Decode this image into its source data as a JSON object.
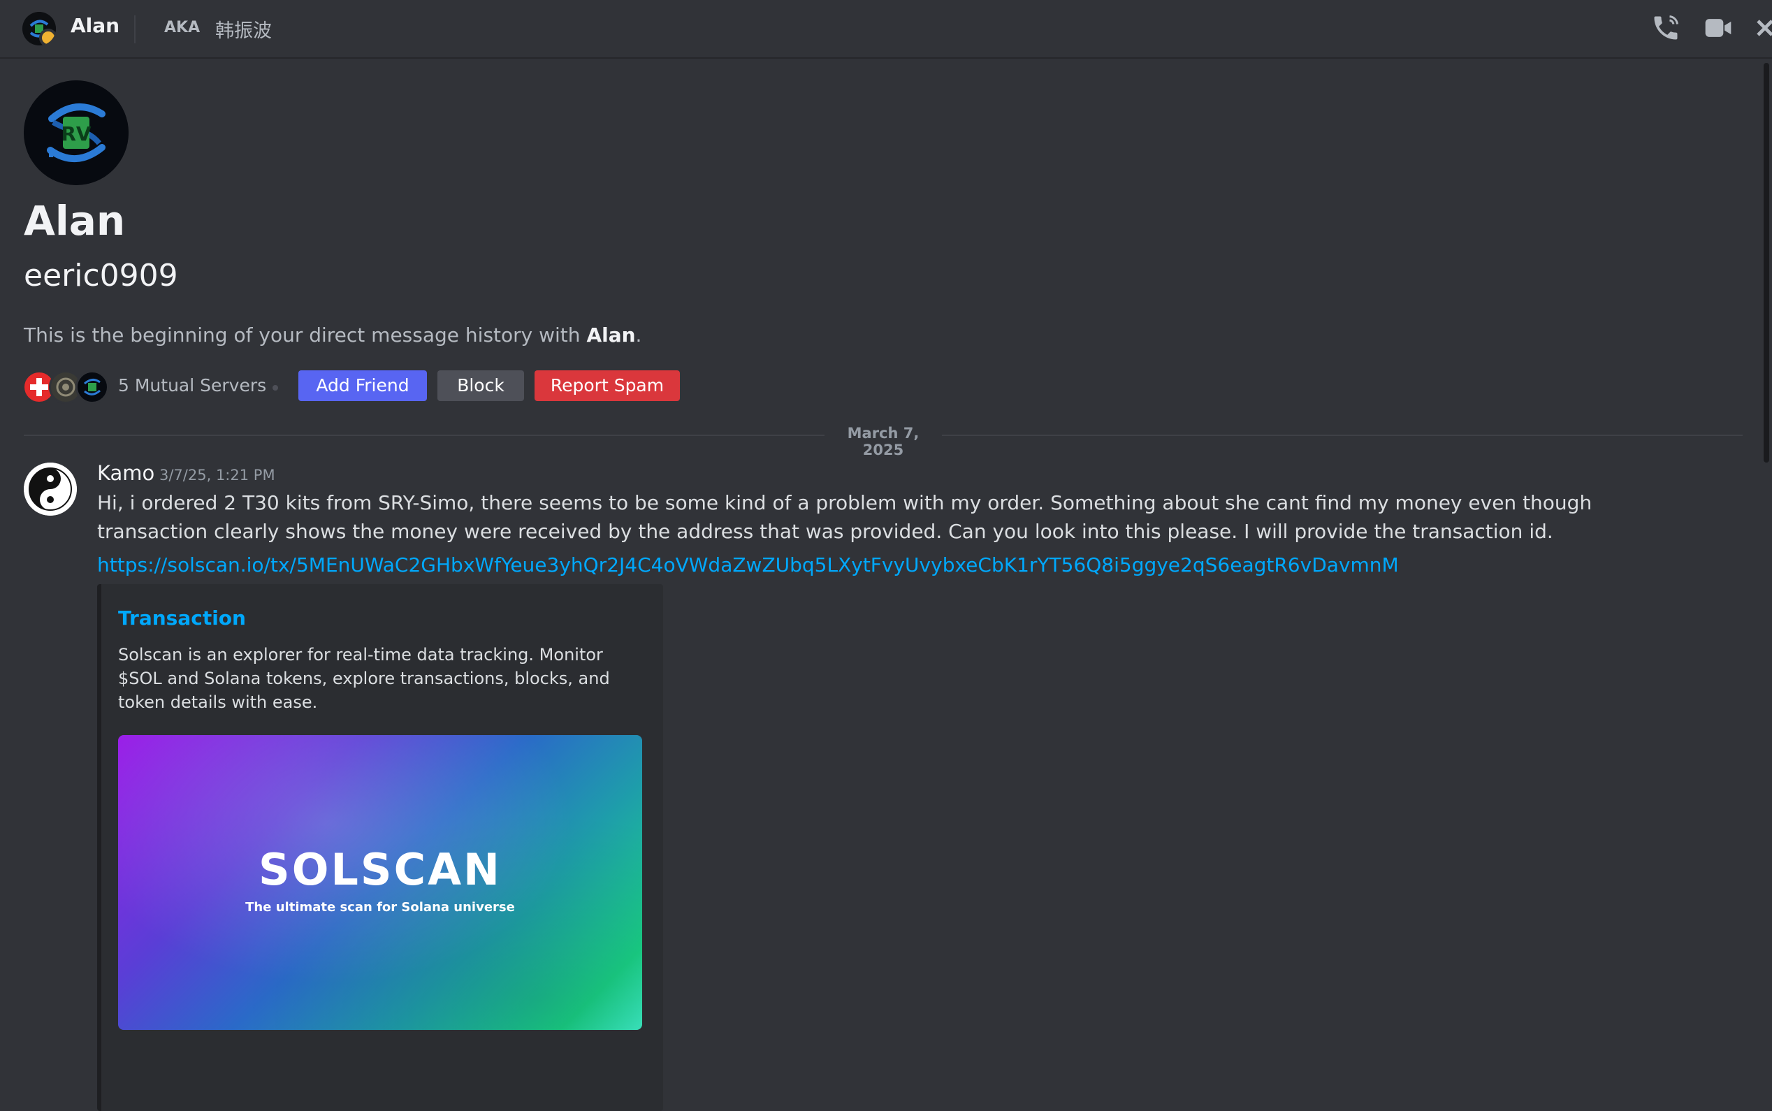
{
  "header": {
    "name": "Alan",
    "aka_label": "AKA",
    "aka_name": "韩振波",
    "icons": [
      "call-icon",
      "video-icon",
      "close-icon"
    ]
  },
  "profile": {
    "display_name": "Alan",
    "username": "eeric0909",
    "intro_prefix": "This is the beginning of your direct message history with ",
    "intro_name": "Alan",
    "intro_suffix": ".",
    "mutual_servers": "5 Mutual Servers"
  },
  "actions": {
    "add_friend": "Add Friend",
    "block": "Block",
    "report_spam": "Report Spam"
  },
  "divider": {
    "date": "March 7, 2025"
  },
  "message": {
    "author": "Kamo",
    "timestamp": "3/7/25, 1:21 PM",
    "text": "Hi, i ordered 2 T30 kits from SRY-Simo, there seems to be some kind of a problem with my order. Something about she cant find my money even though transaction clearly shows the money were received by the address that was provided. Can you look into this please. I will provide the transaction id.",
    "link": "https://solscan.io/tx/5MEnUWaC2GHbxWfYeue3yhQr2J4C4oVWdaZwZUbq5LXytFvyUvybxeCbK1rYT56Q8i5ggye2qS6eagtR6vDavmnM"
  },
  "embed": {
    "title": "Transaction",
    "description": "Solscan is an explorer for real-time data tracking. Monitor $SOL and Solana tokens, explore transactions, blocks, and token details with ease.",
    "image_logo": "SOLSCAN",
    "image_tagline": "The ultimate scan for Solana universe"
  },
  "colors": {
    "background": "#313338",
    "blurple": "#5865f2",
    "danger": "#da373c",
    "secondary": "#4e5058",
    "link": "#00a8fc"
  }
}
